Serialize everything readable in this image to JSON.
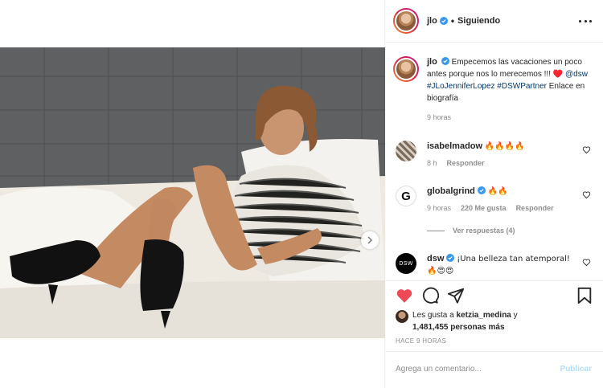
{
  "header": {
    "username": "jlo",
    "separator": "•",
    "follow_status": "Siguiendo",
    "more_icon": "ellipsis-icon"
  },
  "caption": {
    "username": "jlo",
    "text": "Empecemos las vacaciones un poco antes porque nos lo merecemos !!! ♥️",
    "mention": "@dsw",
    "hashtag1": "#JLoJenniferLopez",
    "hashtag2": "#DSWPartner",
    "tail": "Enlace en biografía",
    "time": "9 horas"
  },
  "comments": [
    {
      "username": "isabelmadow",
      "text": "🔥🔥🔥🔥",
      "time": "8 h",
      "reply": "Responder"
    },
    {
      "username": "globalgrind",
      "text": "🔥🔥",
      "time": "9 horas",
      "likes": "220 Me gusta",
      "reply": "Responder"
    },
    {
      "username": "dsw",
      "text": "¡Una belleza tan atemporal! 🔥😍😍"
    }
  ],
  "view_replies": "Ver respuestas (4)",
  "likes": {
    "prefix": "Les gusta a",
    "user": "ketzia_medina",
    "connector": "y",
    "count": "1,481,455 personas más"
  },
  "posted": "HACE 9 HORAS",
  "add_comment": {
    "placeholder": "Agrega un comentario...",
    "publish": "Publicar"
  },
  "colors": {
    "like_red": "#ed4956",
    "link": "#00376b",
    "verified": "#3897f0",
    "publish_disabled": "#b2dffc"
  }
}
